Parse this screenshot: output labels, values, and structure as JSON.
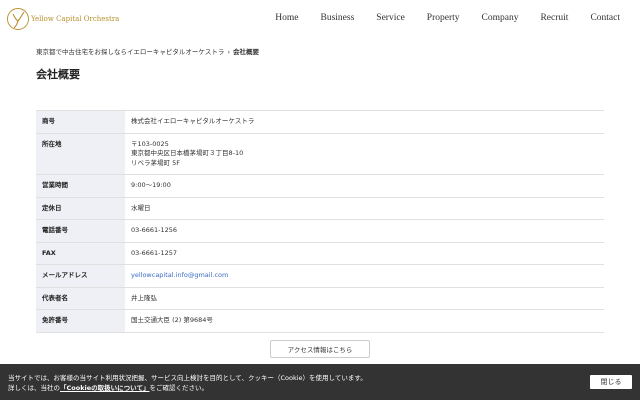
{
  "header": {
    "logo_text": "Yellow Capital Orchestra",
    "brand_color": "#b8902c",
    "nav": [
      "Home",
      "Business",
      "Service",
      "Property",
      "Company",
      "Recruit",
      "Contact"
    ]
  },
  "breadcrumb": {
    "parent": "東京都で中古住宅をお探しならイエローキャピタルオーケストラ",
    "separator": "›",
    "current": "会社概要"
  },
  "page_title": "会社概要",
  "company_info": [
    {
      "label": "商号",
      "lines": [
        "株式会社イエローキャピタルオーケストラ"
      ]
    },
    {
      "label": "所在地",
      "lines": [
        "〒103-0025",
        "東京都中央区日本橋茅場町３丁目8-10",
        "リベラ茅場町 5F"
      ]
    },
    {
      "label": "営業時間",
      "lines": [
        "9:00〜19:00"
      ]
    },
    {
      "label": "定休日",
      "lines": [
        "水曜日"
      ]
    },
    {
      "label": "電話番号",
      "lines": [
        "03-6661-1256"
      ]
    },
    {
      "label": "FAX",
      "lines": [
        "03-6661-1257"
      ]
    },
    {
      "label": "メールアドレス",
      "lines": [
        "yellowcapital.info@gmail.com"
      ],
      "link": true
    },
    {
      "label": "代表者名",
      "lines": [
        "井上隆弘"
      ]
    },
    {
      "label": "免許番号",
      "lines": [
        "国土交通大臣 (2) 第9684号"
      ]
    }
  ],
  "access_button": "アクセス情報はこちら",
  "cookie": {
    "line1": "当サイトでは、お客様の当サイト利用状況把握、サービス向上検討を目的として、クッキー（Cookie）を使用しています。",
    "line2_prefix": "詳しくは、当社の",
    "line2_link": "「Cookieの取扱いについて」",
    "line2_suffix": "をご確認ください。",
    "close": "閉じる"
  }
}
